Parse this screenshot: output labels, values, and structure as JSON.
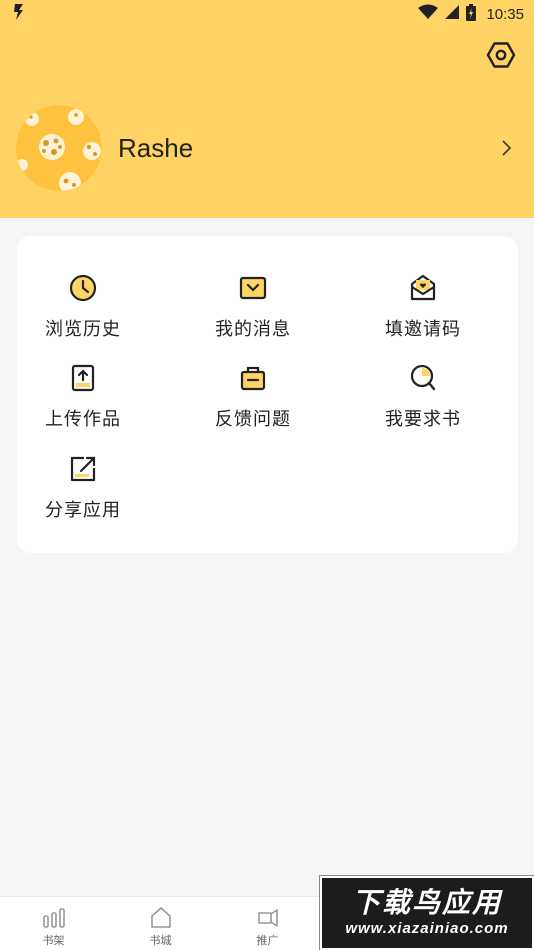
{
  "status_bar": {
    "time": "10:35",
    "icons": [
      "flash-icon",
      "wifi-icon",
      "signal-icon",
      "battery-icon"
    ]
  },
  "header": {
    "background_color": "#ffd464",
    "settings_icon": "settings-icon"
  },
  "profile": {
    "username": "Rashe",
    "avatar": "avatar-image",
    "chevron_icon": "chevron-right-icon"
  },
  "menu": {
    "items": [
      {
        "label": "浏览历史",
        "icon": "clock-icon"
      },
      {
        "label": "我的消息",
        "icon": "message-icon"
      },
      {
        "label": "填邀请码",
        "icon": "invite-icon"
      },
      {
        "label": "上传作品",
        "icon": "upload-icon"
      },
      {
        "label": "反馈问题",
        "icon": "feedback-icon"
      },
      {
        "label": "我要求书",
        "icon": "search-book-icon"
      },
      {
        "label": "分享应用",
        "icon": "share-icon"
      }
    ]
  },
  "bottom_nav": {
    "items": [
      {
        "label": "书架",
        "icon": "bookshelf-icon"
      },
      {
        "label": "书城",
        "icon": "bookstore-icon"
      },
      {
        "label": "推广",
        "icon": "promote-icon"
      }
    ]
  },
  "watermark": {
    "title": "下载鸟应用",
    "url": "www.xiazainiao.com"
  },
  "colors": {
    "accent": "#ffd464",
    "icon_stroke": "#222222",
    "icon_fill": "#ffd464",
    "background": "#f5f5f5"
  }
}
